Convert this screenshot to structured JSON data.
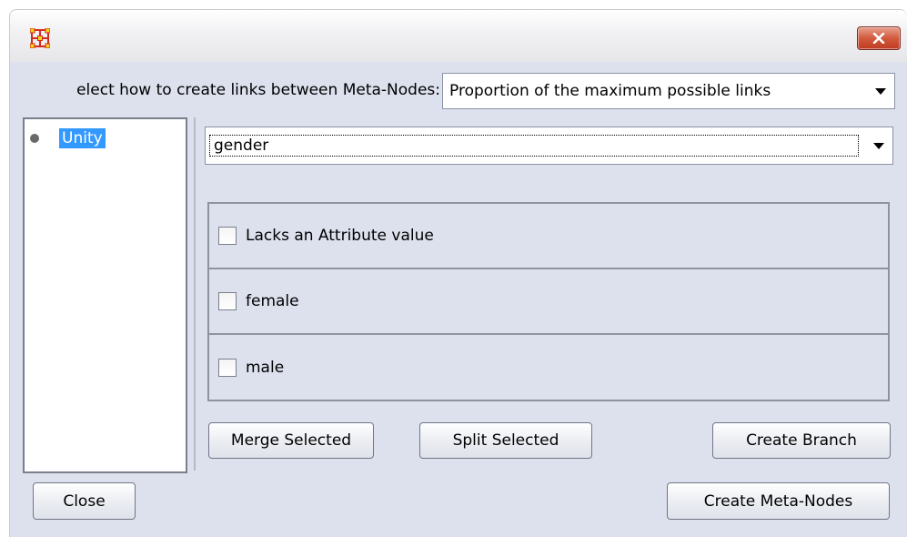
{
  "window": {
    "title": "",
    "app_icon": "network-nodes-icon",
    "close_icon": "close-x-icon"
  },
  "instruction": {
    "label": "elect how to create links between Meta-Nodes:",
    "link_method_value": "Proportion of the maximum possible links"
  },
  "tree": {
    "items": [
      {
        "label": "Unity",
        "selected": true
      }
    ]
  },
  "attribute": {
    "selected": "gender"
  },
  "values": [
    {
      "label": "Lacks an Attribute value",
      "checked": false
    },
    {
      "label": "female",
      "checked": false
    },
    {
      "label": "male",
      "checked": false
    }
  ],
  "buttons": {
    "merge_selected": "Merge Selected",
    "split_selected": "Split Selected",
    "create_branch": "Create Branch",
    "close": "Close",
    "create_meta_nodes": "Create Meta-Nodes"
  },
  "colors": {
    "client_bg": "#dde1ee",
    "selection": "#3399ff",
    "close_button": "#c03a22",
    "app_icon_red": "#d42b1e",
    "app_icon_yellow": "#f2d21a"
  }
}
